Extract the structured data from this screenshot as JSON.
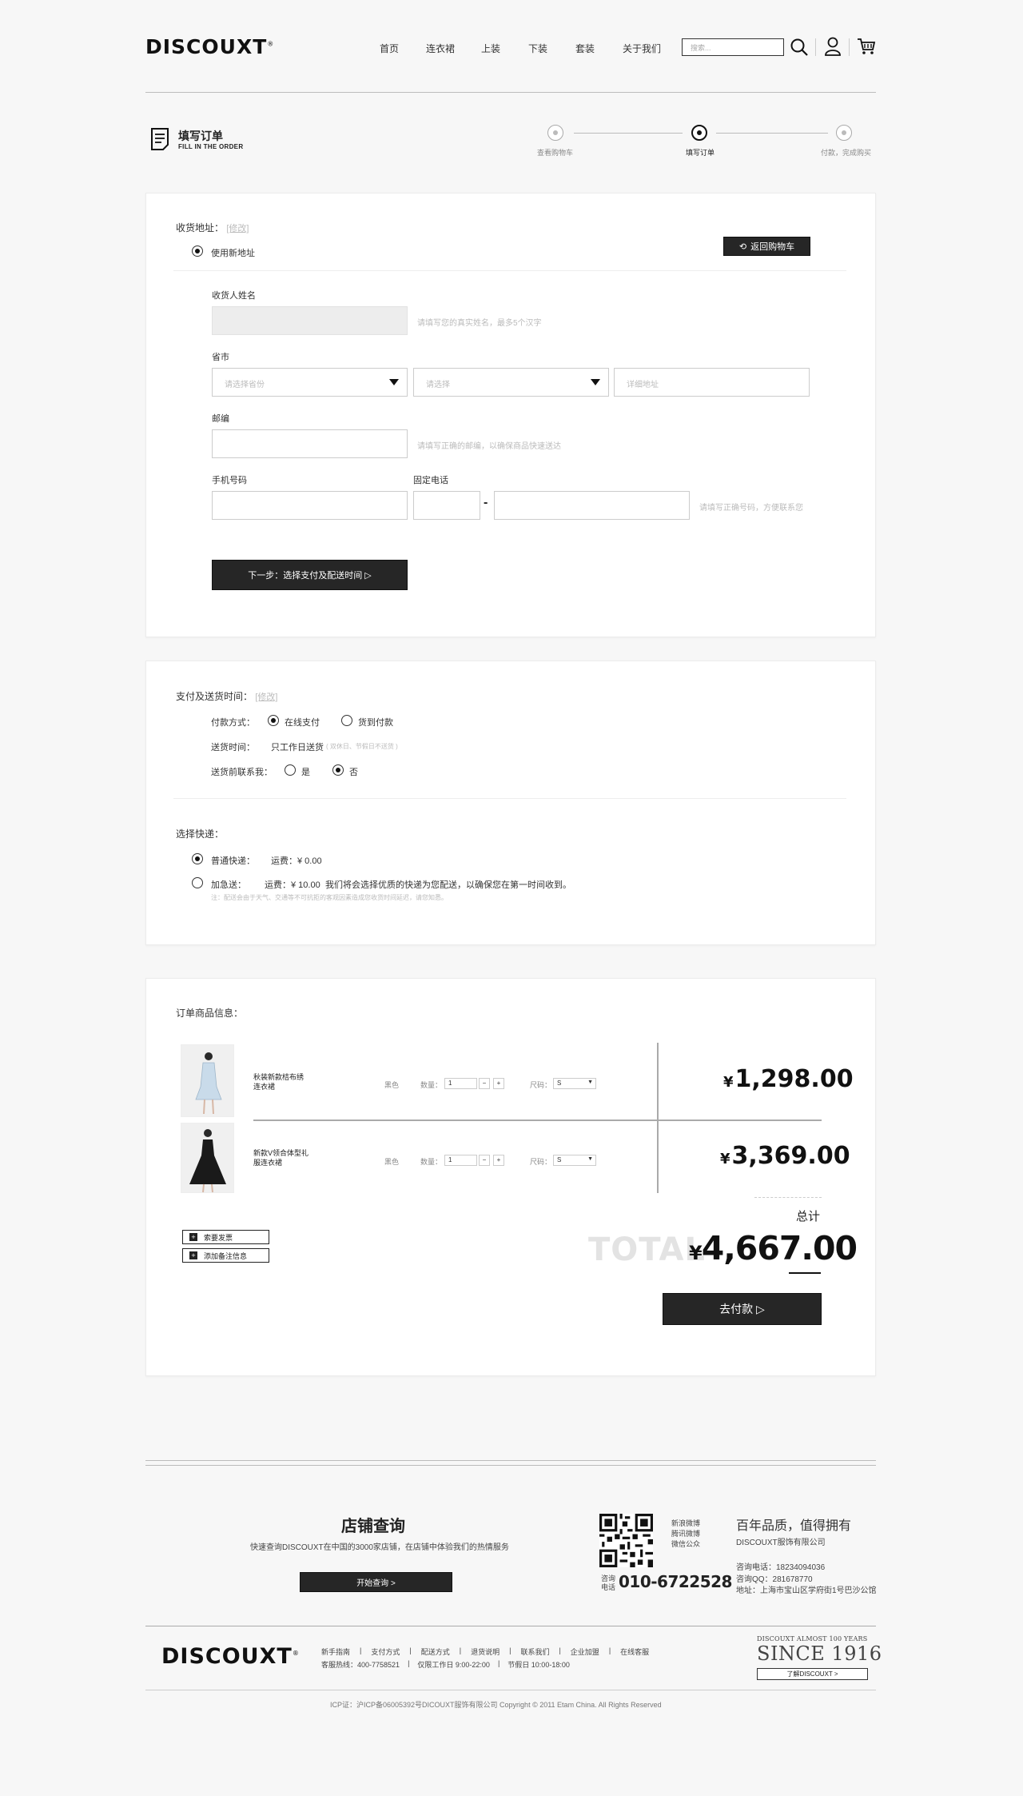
{
  "header": {
    "logo": "DISCOUXT",
    "logo_mark": "®",
    "nav": [
      "首页",
      "连衣裙",
      "上装",
      "下装",
      "套装",
      "关于我们"
    ],
    "search_placeholder": "搜索..."
  },
  "page_heading": {
    "title": "填写订单",
    "subtitle": "FILL IN THE ORDER"
  },
  "steps": [
    {
      "label": "查看购物车",
      "active": false
    },
    {
      "label": "填写订单",
      "active": true
    },
    {
      "label": "付款，完成购买",
      "active": false
    }
  ],
  "address": {
    "title": "收货地址：",
    "edit": "[修改]",
    "use_new": "使用新地址",
    "back_cart": "返回购物车",
    "name_label": "收货人姓名",
    "name_hint": "请填写您的真实姓名，最多5个汉字",
    "province_label": "省市",
    "province_placeholder": "请选择省份",
    "city_placeholder": "请选择",
    "detail_placeholder": "详细地址",
    "zip_label": "邮编",
    "zip_hint": "请填写正确的邮编，以确保商品快速送达",
    "mobile_label": "手机号码",
    "phone_label": "固定电话",
    "phone_dash": "-",
    "phone_hint": "请填写正确号码，方便联系您",
    "next_button": "下一步：选择支付及配送时间 ▷"
  },
  "payment": {
    "title": "支付及送货时间：",
    "edit": "[修改]",
    "pay_label": "付款方式：",
    "pay_online": "在线支付",
    "pay_cod": "货到付款",
    "time_label": "送货时间：",
    "time_value": "只工作日送货",
    "time_note": "( 双休日、节假日不送货 )",
    "contact_label": "送货前联系我：",
    "contact_yes": "是",
    "contact_no": "否",
    "express_title": "选择快递：",
    "normal": "普通快递：",
    "normal_fee": "运费：¥ 0.00",
    "fast": "加急送：",
    "fast_fee": "运费：¥ 10.00",
    "fast_desc": "我们将会选择优质的快递为您配送，以确保您在第一时间收到。",
    "note": "注：配送会由于天气、交通等不可抗拒的客观因素造成您收货时间延迟，请您知悉。"
  },
  "order": {
    "title": "订单商品信息：",
    "items": [
      {
        "name": "秋装新款桔布绣连衣裙",
        "color": "黑色",
        "qty_label": "数量：",
        "qty": "1",
        "size_label": "尺码：",
        "size": "S",
        "price": "1,298.00"
      },
      {
        "name": "新款V领合体型礼服连衣裙",
        "color": "黑色",
        "qty_label": "数量：",
        "qty": "1",
        "size_label": "尺码：",
        "size": "S",
        "price": "3,369.00"
      }
    ],
    "invoice": "索要发票",
    "remark": "添加备注信息",
    "total_label": "总计",
    "total_word": "TOTAL",
    "total": "4,667.00",
    "yen": "¥",
    "pay_button": "去付款 ▷"
  },
  "footer": {
    "store_title": "店铺查询",
    "store_desc": "快速查询DISCOUXT在中国的3000家店铺，在店铺中体验我们的热情服务",
    "store_button": "开始查询 >",
    "social": [
      "新浪微博",
      "腾讯微博",
      "微信公众"
    ],
    "hotline_label_1": "咨询",
    "hotline_label_2": "电话",
    "hotline": "010-6722528",
    "slogan": "百年品质，值得拥有",
    "company": "DISCOUXT服饰有限公司",
    "contact_phone": "咨询电话：18234094036",
    "contact_qq": "咨询QQ：281678770",
    "contact_addr": "地址：上海市宝山区学府街1号巴沙公馆",
    "links": [
      "新手指南",
      "支付方式",
      "配送方式",
      "退货说明",
      "联系我们",
      "企业加盟",
      "在线客服"
    ],
    "service_line": "客服热线：400-7758521",
    "workday": "仅限工作日 9:00-22:00",
    "holiday": "节假日 10:00-18:00",
    "brand_tag": "DISCOUXT ALMOST 100 YEARS",
    "since": "SINCE 1916",
    "learn": "了解DISCOUXT >",
    "copyright": "ICP证：沪ICP备06005392号DICOUXT服饰有限公司 Copyright © 2011 Etam China. All Rights Reserved"
  }
}
